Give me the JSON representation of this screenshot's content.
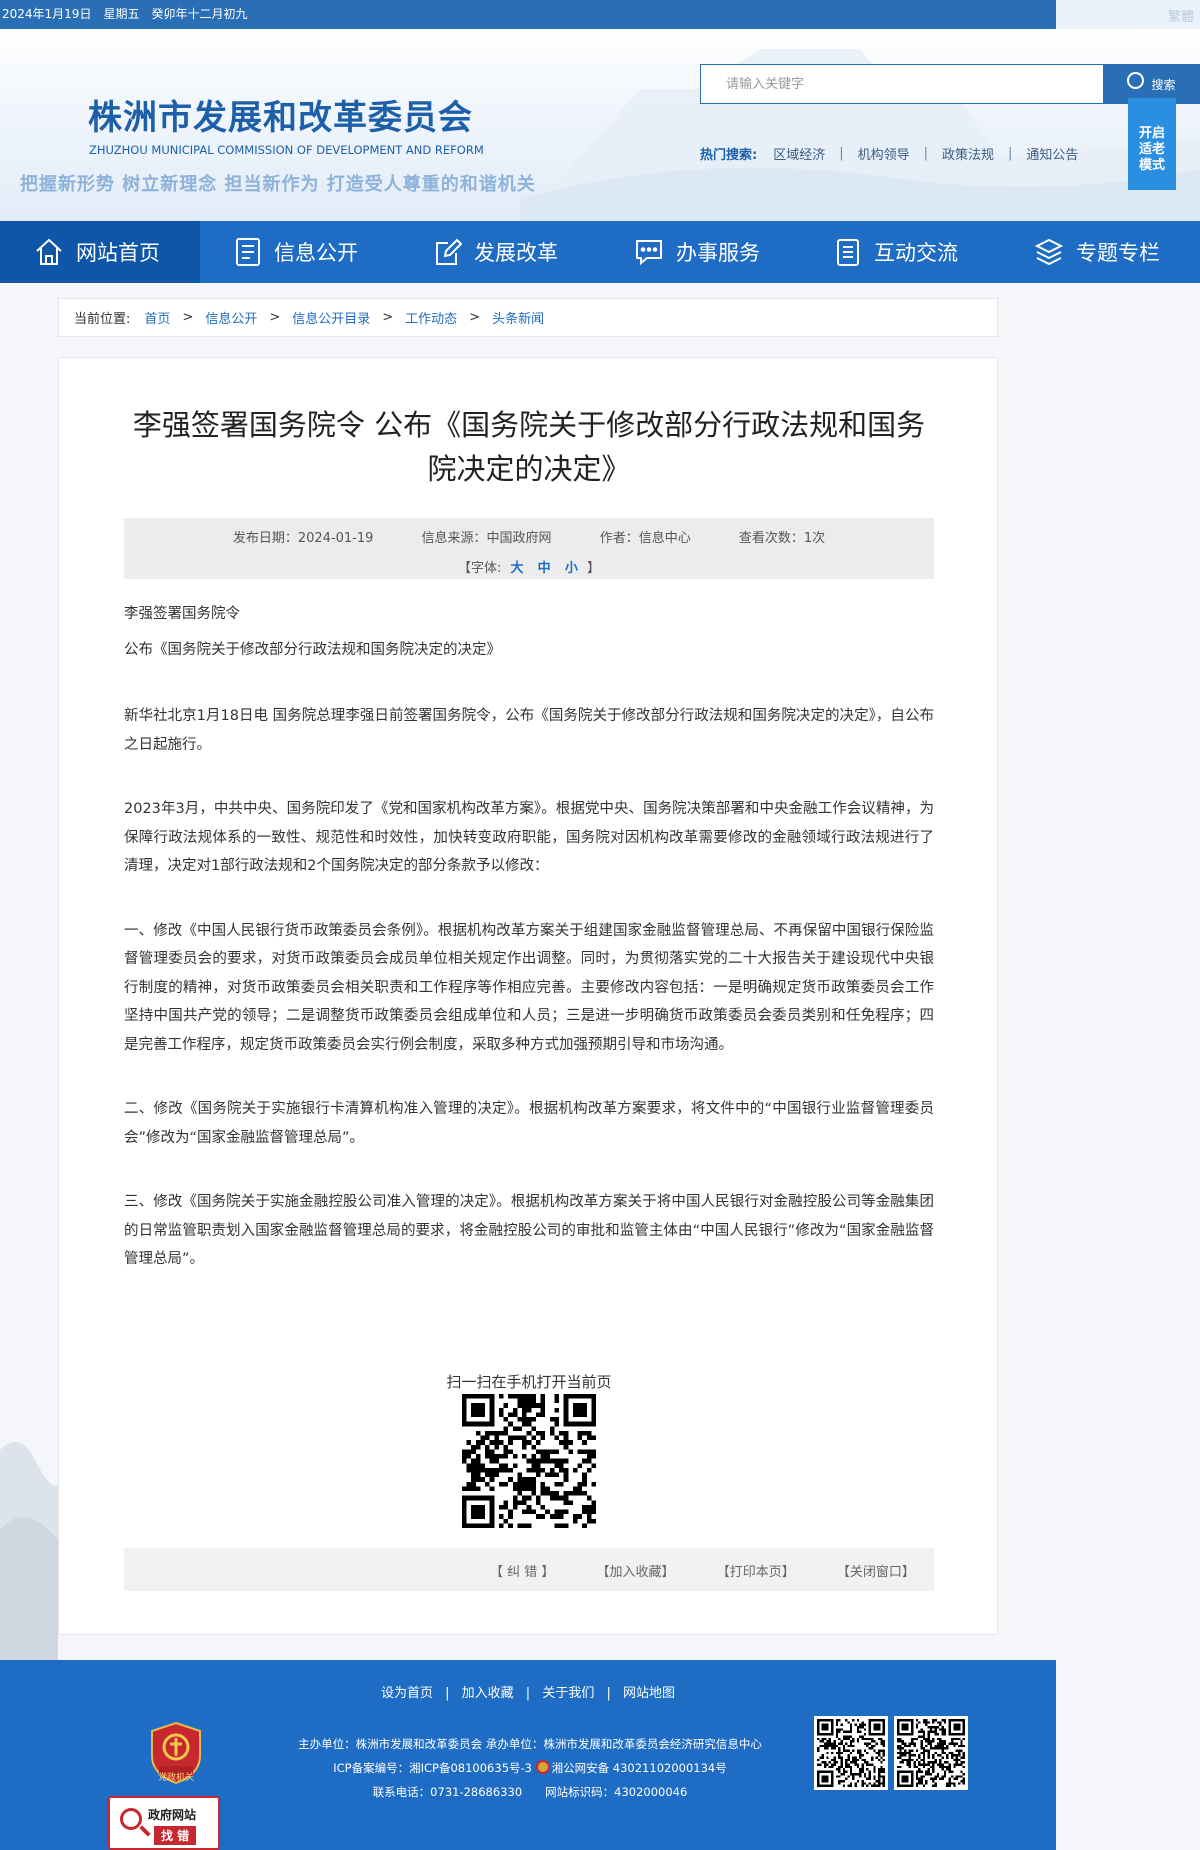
{
  "topbar": {
    "date_text": "2024年1月19日　星期五　癸卯年十二月初九",
    "right_text": "繁體"
  },
  "header": {
    "title": "株洲市发展和改革委员会",
    "subtitle": "ZHUZHOU MUNICIPAL COMMISSION OF DEVELOPMENT AND REFORM",
    "slogan": "把握新形势 树立新理念 担当新作为 打造受人尊重的和谐机关",
    "search_placeholder": "请输入关键字",
    "search_label": "搜索",
    "hot_label": "热门搜索:",
    "hot_links": [
      "区域经济",
      "机构领导",
      "政策法规",
      "通知公告"
    ],
    "elder_mode": [
      "开启",
      "适老",
      "模式"
    ]
  },
  "nav": {
    "items": [
      {
        "label": "网站首页",
        "icon": "home-icon"
      },
      {
        "label": "信息公开",
        "icon": "document-list-icon"
      },
      {
        "label": "发展改革",
        "icon": "edit-icon"
      },
      {
        "label": "办事服务",
        "icon": "chat-icon"
      },
      {
        "label": "互动交流",
        "icon": "clipboard-icon"
      },
      {
        "label": "专题专栏",
        "icon": "layers-icon"
      }
    ]
  },
  "breadcrumb": {
    "label": "当前位置:",
    "items": [
      "首页",
      "信息公开",
      "信息公开目录",
      "工作动态",
      "头条新闻"
    ],
    "sep": ">"
  },
  "article": {
    "title": "李强签署国务院令 公布《国务院关于修改部分行政法规和国务院决定的决定》",
    "meta": {
      "date": "发布日期：2024-01-19",
      "source": "信息来源：中国政府网",
      "author": "作者：信息中心",
      "views": "查看次数：1次",
      "font_prefix": "【字体:",
      "font_large": "大",
      "font_medium": "中",
      "font_small": "小",
      "font_suffix": "】"
    },
    "lead1": "李强签署国务院令",
    "lead2": "公布《国务院关于修改部分行政法规和国务院决定的决定》",
    "p1": "新华社北京1月18日电  国务院总理李强日前签署国务院令，公布《国务院关于修改部分行政法规和国务院决定的决定》，自公布之日起施行。",
    "p2": "2023年3月，中共中央、国务院印发了《党和国家机构改革方案》。根据党中央、国务院决策部署和中央金融工作会议精神，为保障行政法规体系的一致性、规范性和时效性，加快转变政府职能，国务院对因机构改革需要修改的金融领域行政法规进行了清理，决定对1部行政法规和2个国务院决定的部分条款予以修改：",
    "p3": "一、修改《中国人民银行货币政策委员会条例》。根据机构改革方案关于组建国家金融监督管理总局、不再保留中国银行保险监督管理委员会的要求，对货币政策委员会成员单位相关规定作出调整。同时，为贯彻落实党的二十大报告关于建设现代中央银行制度的精神，对货币政策委员会相关职责和工作程序等作相应完善。主要修改内容包括：一是明确规定货币政策委员会工作坚持中国共产党的领导；二是调整货币政策委员会组成单位和人员；三是进一步明确货币政策委员会委员类别和任免程序；四是完善工作程序，规定货币政策委员会实行例会制度，采取多种方式加强预期引导和市场沟通。",
    "p4": "二、修改《国务院关于实施银行卡清算机构准入管理的决定》。根据机构改革方案要求，将文件中的“中国银行业监督管理委员会”修改为“国家金融监督管理总局”。",
    "p5": "三、修改《国务院关于实施金融控股公司准入管理的决定》。根据机构改革方案关于将中国人民银行对金融控股公司等金融集团的日常监管职责划入国家金融监督管理总局的要求，将金融控股公司的审批和监管主体由“中国人民银行”修改为“国家金融监督管理总局”。",
    "qr_caption": "扫一扫在手机打开当前页",
    "tools": [
      "【 纠 错 】",
      "【加入收藏】",
      "【打印本页】",
      "【关闭窗口】"
    ]
  },
  "footer": {
    "links": [
      "设为首页",
      "加入收藏",
      "关于我们",
      "网站地图"
    ],
    "line1": "主办单位：株洲市发展和改革委员会 承办单位：株洲市发展和改革委员会经济研究信息中心",
    "line2a": "ICP备案编号：湘ICP备08100635号-3",
    "line2b": "湘公网安备 43021102000134号",
    "line3": "联系电话：0731-28686330　　网站标识码：4302000046",
    "badge_party": "党政机关",
    "badge_gov_1": "政府网站",
    "badge_gov_2": "找 错"
  }
}
